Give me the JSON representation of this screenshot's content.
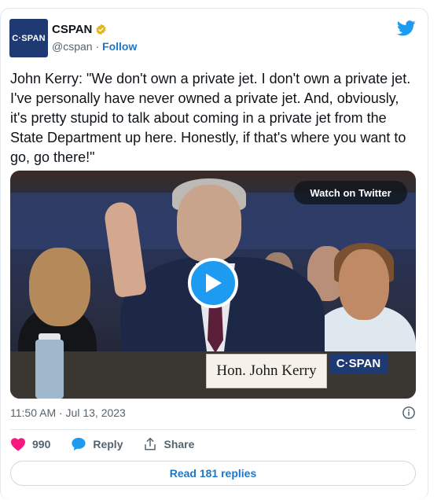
{
  "author": {
    "avatar_text": "C·SPAN",
    "name": "CSPAN",
    "handle": "@cspan",
    "separator": " · ",
    "follow_label": "Follow"
  },
  "tweet": {
    "text": "John Kerry: \"We don't own a private jet. I don't own a private jet. I've personally have never owned a private jet. And, obviously, it's pretty stupid to talk about coming in a private jet from the State Department up here. Honestly, if that's where you want to go, go there!\""
  },
  "media": {
    "watch_label": "Watch on Twitter",
    "nameplate": "Hon. John Kerry",
    "bug_text": "C·SPAN"
  },
  "meta": {
    "timestamp": "11:50 AM · Jul 13, 2023"
  },
  "actions": {
    "likes": "990",
    "reply_label": "Reply",
    "share_label": "Share"
  },
  "read_replies_label": "Read 181 replies",
  "colors": {
    "brand_blue": "#1d9bf0",
    "link_blue": "#1d77c9",
    "cspan_navy": "#1f3a72",
    "like_pink": "#f91880"
  },
  "icons": [
    "verified-badge-icon",
    "twitter-bird-icon",
    "play-icon",
    "info-icon",
    "heart-icon",
    "reply-bubble-icon",
    "share-icon"
  ]
}
